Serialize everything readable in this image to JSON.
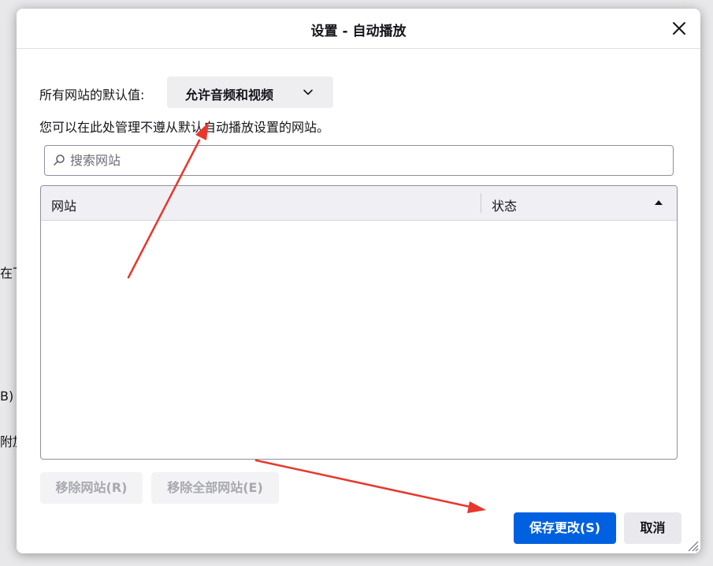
{
  "background": {
    "fragment_1": "在下",
    "fragment_2": "B)",
    "fragment_3": "附加"
  },
  "dialog": {
    "title": "设置 - 自动播放",
    "close_icon": "close-icon",
    "default_label": "所有网站的默认值:",
    "default_value": "允许音频和视频",
    "description": "您可以在此处管理不遵从默认自动播放设置的网站。",
    "search_placeholder": "搜索网站",
    "table": {
      "columns": [
        "网站",
        "状态"
      ],
      "sort_direction": "ascending",
      "rows": []
    },
    "buttons": {
      "remove": "移除网站(R)",
      "remove_all": "移除全部网站(E)",
      "save": "保存更改(S)",
      "cancel": "取消"
    }
  },
  "colors": {
    "accent": "#0061e0",
    "annotation_arrow": "#e8372d"
  }
}
